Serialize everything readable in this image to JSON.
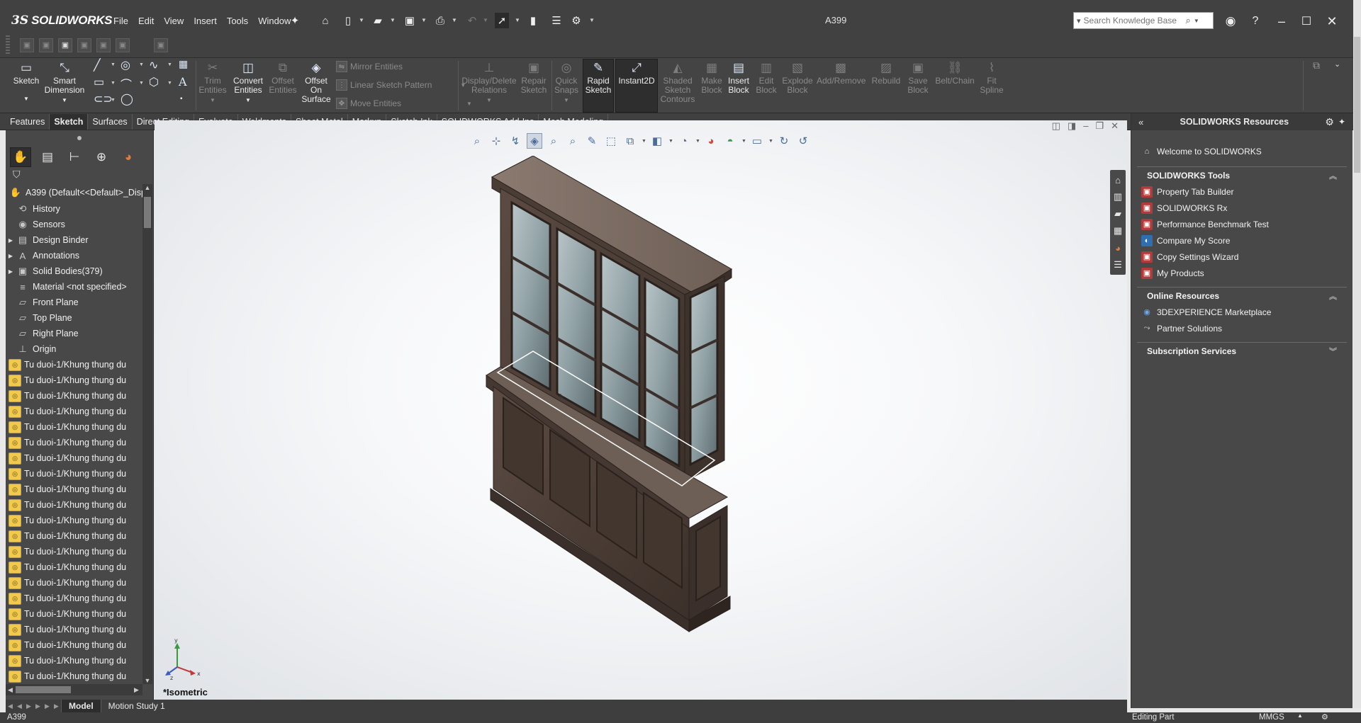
{
  "app": {
    "logo_ds": "3S",
    "logo_name": "SOLIDWORKS",
    "doc_title": "A399"
  },
  "menu": [
    "File",
    "Edit",
    "View",
    "Insert",
    "Tools",
    "Window"
  ],
  "search": {
    "placeholder": "Search Knowledge Base"
  },
  "commands": {
    "sketch": "Sketch",
    "smart_dim_1": "Smart",
    "smart_dim_2": "Dimension",
    "trim_1": "Trim",
    "trim_2": "Entities",
    "convert_1": "Convert",
    "convert_2": "Entities",
    "offset_ent_1": "Offset",
    "offset_ent_2": "Entities",
    "offset_surf_1": "Offset",
    "offset_surf_2": "On",
    "offset_surf_3": "Surface",
    "mirror": "Mirror Entities",
    "linear_pattern": "Linear Sketch Pattern",
    "move": "Move Entities",
    "display_delete_1": "Display/Delete",
    "display_delete_2": "Relations",
    "repair_1": "Repair",
    "repair_2": "Sketch",
    "quick_snaps_1": "Quick",
    "quick_snaps_2": "Snaps",
    "rapid_1": "Rapid",
    "rapid_2": "Sketch",
    "instant2d": "Instant2D",
    "shaded_1": "Shaded",
    "shaded_2": "Sketch",
    "shaded_3": "Contours",
    "make_block_1": "Make",
    "make_block_2": "Block",
    "insert_block_1": "Insert",
    "insert_block_2": "Block",
    "edit_block_1": "Edit",
    "edit_block_2": "Block",
    "explode_block_1": "Explode",
    "explode_block_2": "Block",
    "add_remove": "Add/Remove",
    "rebuild": "Rebuild",
    "save_block_1": "Save",
    "save_block_2": "Block",
    "belt_chain": "Belt/Chain",
    "fit_spline_1": "Fit",
    "fit_spline_2": "Spline"
  },
  "tabs": [
    "Features",
    "Sketch",
    "Surfaces",
    "Direct Editing",
    "Evaluate",
    "Weldments",
    "Sheet Metal",
    "Markup",
    "Sketch Ink",
    "SOLIDWORKS Add-Ins",
    "Mesh Modeling"
  ],
  "active_tab": "Sketch",
  "tree": {
    "root": "A399  (Default<<Default>_Disp",
    "items": [
      {
        "label": "History",
        "icon": "history-icon",
        "expand": false
      },
      {
        "label": "Sensors",
        "icon": "sensors-icon",
        "expand": false
      },
      {
        "label": "Design Binder",
        "icon": "design-binder-icon",
        "expand": true
      },
      {
        "label": "Annotations",
        "icon": "annotations-icon",
        "expand": true
      },
      {
        "label": "Solid Bodies(379)",
        "icon": "solid-bodies-icon",
        "expand": true
      },
      {
        "label": "Material <not specified>",
        "icon": "material-icon",
        "expand": false
      },
      {
        "label": "Front Plane",
        "icon": "plane-icon",
        "expand": false
      },
      {
        "label": "Top Plane",
        "icon": "plane-icon",
        "expand": false
      },
      {
        "label": "Right Plane",
        "icon": "plane-icon",
        "expand": false
      },
      {
        "label": "Origin",
        "icon": "origin-icon",
        "expand": false
      }
    ],
    "feature_label": "Tu duoi-1/Khung thung du",
    "feature_count": 21
  },
  "viewport": {
    "view_name": "*Isometric"
  },
  "resources": {
    "title": "SOLIDWORKS Resources",
    "welcome": "Welcome to SOLIDWORKS",
    "tools_header": "SOLIDWORKS Tools",
    "tools": [
      "Property Tab Builder",
      "SOLIDWORKS Rx",
      "Performance Benchmark Test",
      "Compare My Score",
      "Copy Settings Wizard",
      "My Products"
    ],
    "online_header": "Online Resources",
    "online": [
      "3DEXPERIENCE Marketplace",
      "Partner Solutions"
    ],
    "subscription_header": "Subscription Services"
  },
  "bottom_tabs": [
    "Model",
    "Motion Study 1"
  ],
  "status": {
    "left": "A399",
    "editing": "Editing Part",
    "units": "MMGS"
  },
  "colors": {
    "chrome": "#414141",
    "accent": "#f2c94c",
    "wood": "#4a3d36"
  }
}
